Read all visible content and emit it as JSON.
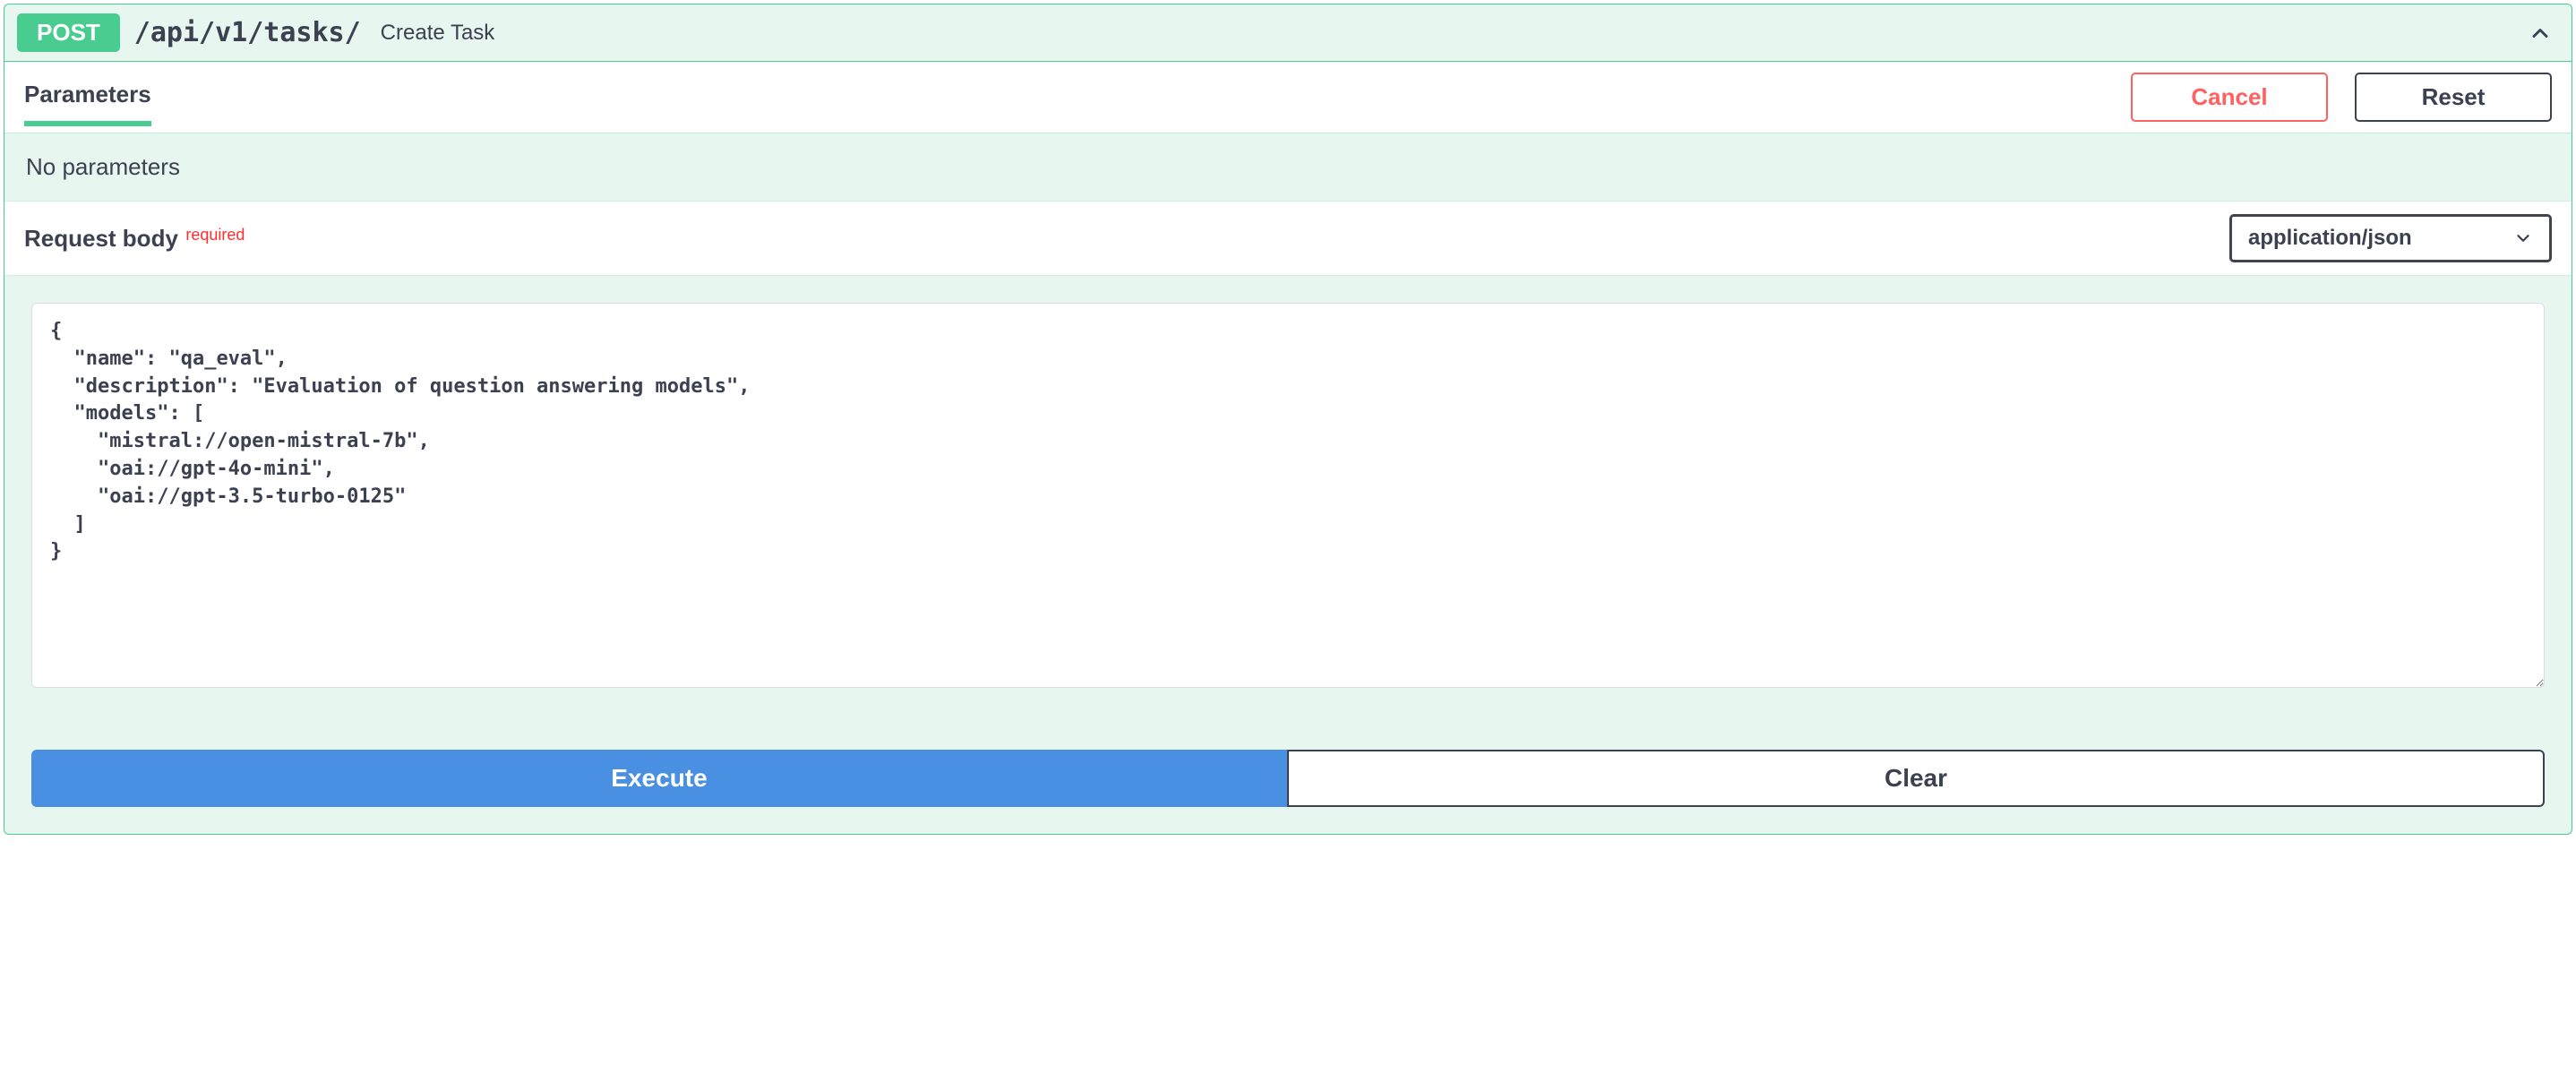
{
  "endpoint": {
    "method": "POST",
    "path": "/api/v1/tasks/",
    "summary": "Create Task"
  },
  "tabs": {
    "parameters_label": "Parameters"
  },
  "actions": {
    "cancel": "Cancel",
    "reset": "Reset",
    "execute": "Execute",
    "clear": "Clear"
  },
  "parameters": {
    "empty_text": "No parameters"
  },
  "request_body": {
    "label": "Request body",
    "required_tag": "required",
    "content_type": "application/json",
    "value": "{\n  \"name\": \"qa_eval\",\n  \"description\": \"Evaluation of question answering models\",\n  \"models\": [\n    \"mistral://open-mistral-7b\",\n    \"oai://gpt-4o-mini\",\n    \"oai://gpt-3.5-turbo-0125\"\n  ]\n}"
  }
}
